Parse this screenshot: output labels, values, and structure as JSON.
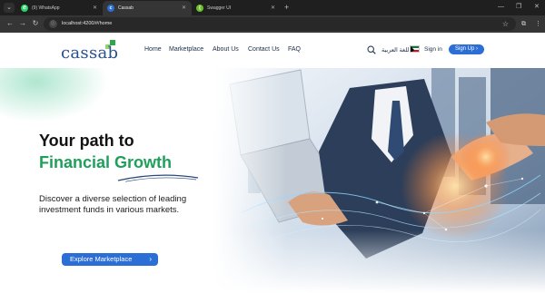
{
  "browser": {
    "tabs": [
      {
        "title": "(9) WhatsApp",
        "icon": "whatsapp-icon",
        "active": false
      },
      {
        "title": "Cassab",
        "icon": "cassab-favicon",
        "active": true
      },
      {
        "title": "Swagger UI",
        "icon": "swagger-icon",
        "active": false
      }
    ],
    "url": "localhost:4200/#/home"
  },
  "colors": {
    "brand_blue": "#2b6fd6",
    "logo_blue": "#294f8f",
    "growth_green": "#1fa05a",
    "dark_text": "#121212"
  },
  "header": {
    "logo_text": "cassab",
    "nav": [
      "Home",
      "Marketplace",
      "About Us",
      "Contact Us",
      "FAQ"
    ],
    "language": "اللغة العربية",
    "sign_in": "Sign in",
    "sign_up": "Sign Up ›"
  },
  "hero": {
    "title_line1": "Your path to",
    "title_line2": "Financial Growth",
    "subtitle": "Discover a diverse selection of leading investment funds in various markets.",
    "cta": "Explore Marketplace"
  }
}
